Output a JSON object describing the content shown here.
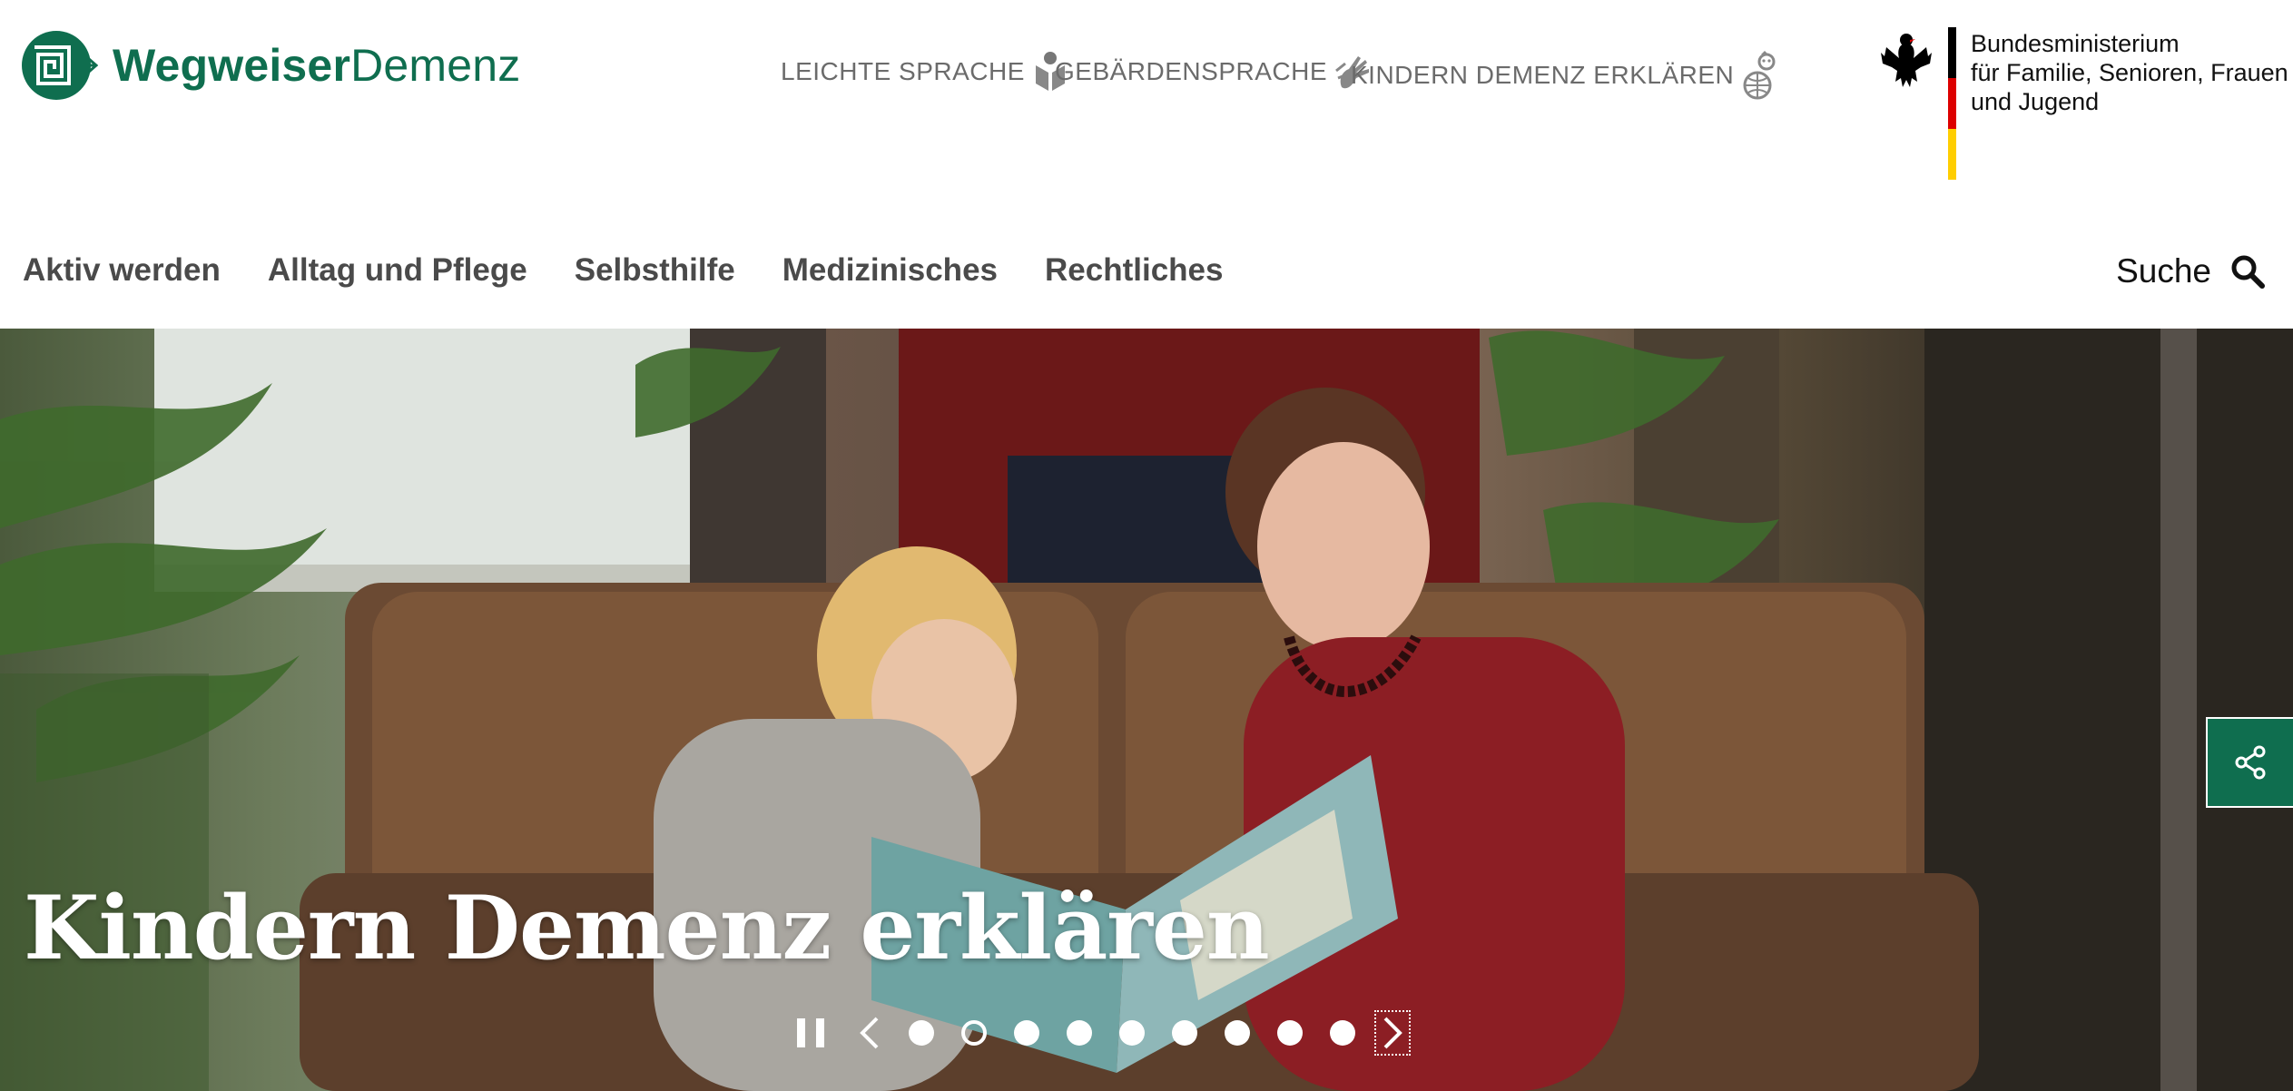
{
  "header": {
    "logo": {
      "part1": "Wegweiser",
      "part2": "Demenz"
    },
    "accessibility": [
      {
        "label": "LEICHTE SPRACHE",
        "icon": "leichte-sprache-icon"
      },
      {
        "label": "GEBÄRDENSPRACHE",
        "icon": "sign-language-icon"
      },
      {
        "label": "KINDERN DEMENZ ERKLÄREN",
        "icon": "kinder-globe-icon"
      }
    ],
    "ministry": {
      "line1": "Bundesministerium",
      "line2": "für Familie, Senioren, Frauen",
      "line3": "und Jugend",
      "flag_colors": [
        "#000000",
        "#dd0000",
        "#ffce00"
      ]
    }
  },
  "nav": {
    "items": [
      "Aktiv werden",
      "Alltag und Pflege",
      "Selbsthilfe",
      "Medizinisches",
      "Rechtliches"
    ],
    "search_label": "Suche"
  },
  "hero": {
    "title": "Kindern Demenz erklären",
    "slide_count": 9,
    "active_slide": 2
  },
  "colors": {
    "brand_green": "#0f6e4f",
    "accent_green": "#2f8d6b"
  }
}
